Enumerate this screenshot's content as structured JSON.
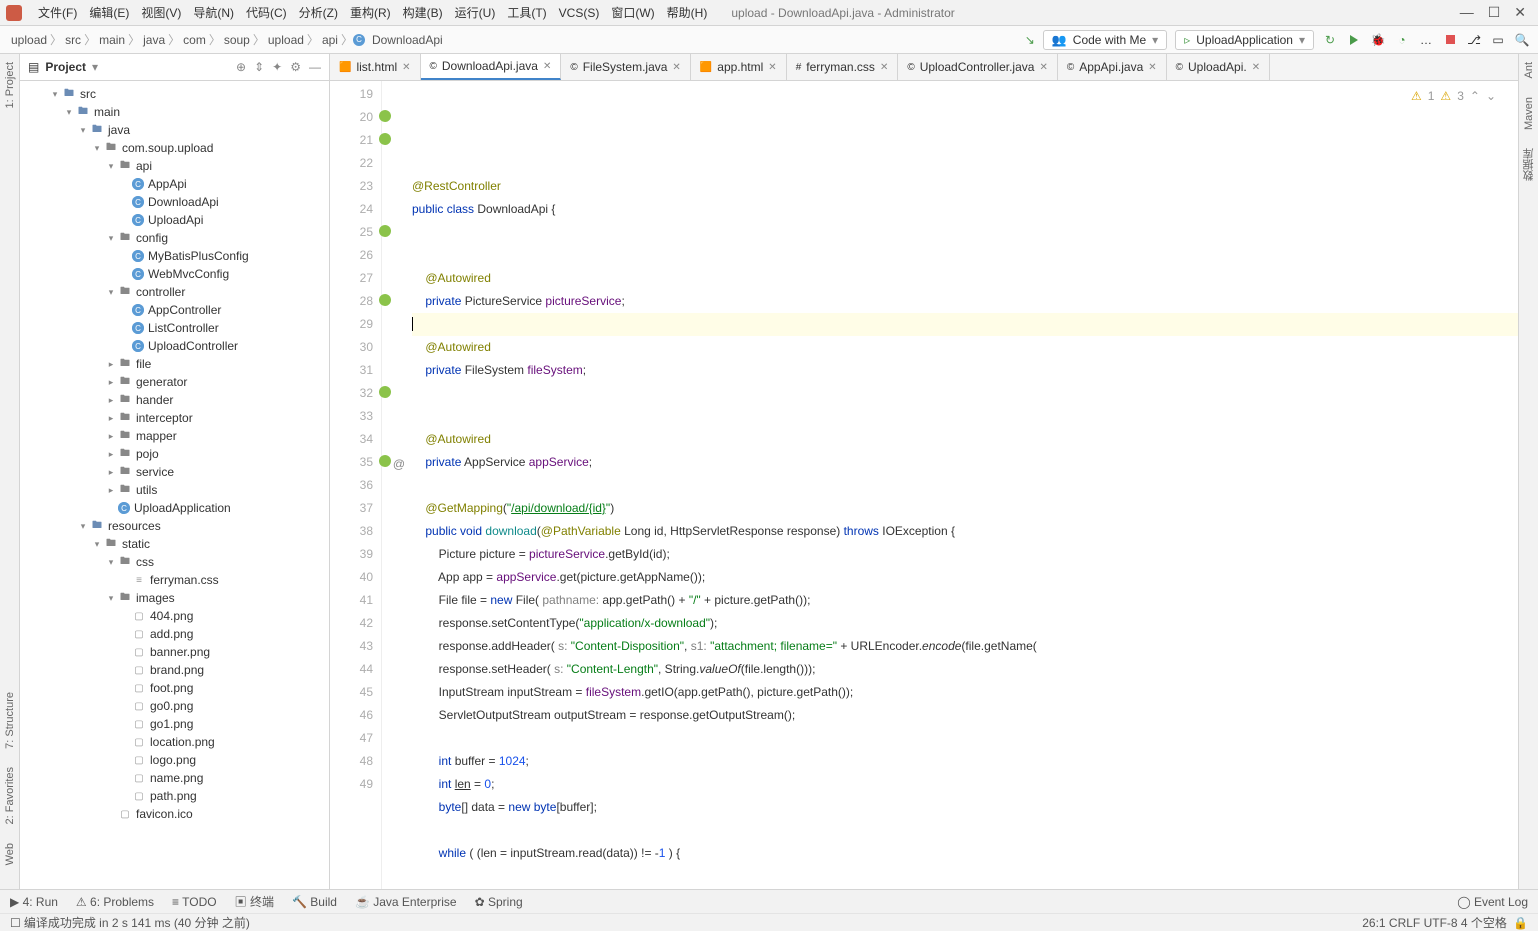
{
  "window_title": "upload - DownloadApi.java - Administrator",
  "menu": [
    "文件(F)",
    "编辑(E)",
    "视图(V)",
    "导航(N)",
    "代码(C)",
    "分析(Z)",
    "重构(R)",
    "构建(B)",
    "运行(U)",
    "工具(T)",
    "VCS(S)",
    "窗口(W)",
    "帮助(H)"
  ],
  "breadcrumbs": [
    "upload",
    "src",
    "main",
    "java",
    "com",
    "soup",
    "upload",
    "api",
    "DownloadApi"
  ],
  "code_with_me": "Code with Me",
  "run_config": "UploadApplication",
  "sidebar_title": "Project",
  "tree": [
    {
      "d": 2,
      "t": "src",
      "tw": "▾",
      "ic": "folder-b"
    },
    {
      "d": 3,
      "t": "main",
      "tw": "▾",
      "ic": "folder-b"
    },
    {
      "d": 4,
      "t": "java",
      "tw": "▾",
      "ic": "folder-b"
    },
    {
      "d": 5,
      "t": "com.soup.upload",
      "tw": "▾",
      "ic": "folder-g"
    },
    {
      "d": 6,
      "t": "api",
      "tw": "▾",
      "ic": "folder-g"
    },
    {
      "d": 7,
      "t": "AppApi",
      "tw": "",
      "ic": "cls"
    },
    {
      "d": 7,
      "t": "DownloadApi",
      "tw": "",
      "ic": "cls"
    },
    {
      "d": 7,
      "t": "UploadApi",
      "tw": "",
      "ic": "cls"
    },
    {
      "d": 6,
      "t": "config",
      "tw": "▾",
      "ic": "folder-g"
    },
    {
      "d": 7,
      "t": "MyBatisPlusConfig",
      "tw": "",
      "ic": "cls"
    },
    {
      "d": 7,
      "t": "WebMvcConfig",
      "tw": "",
      "ic": "cls"
    },
    {
      "d": 6,
      "t": "controller",
      "tw": "▾",
      "ic": "folder-g"
    },
    {
      "d": 7,
      "t": "AppController",
      "tw": "",
      "ic": "cls"
    },
    {
      "d": 7,
      "t": "ListController",
      "tw": "",
      "ic": "cls"
    },
    {
      "d": 7,
      "t": "UploadController",
      "tw": "",
      "ic": "cls"
    },
    {
      "d": 6,
      "t": "file",
      "tw": "▸",
      "ic": "folder-g"
    },
    {
      "d": 6,
      "t": "generator",
      "tw": "▸",
      "ic": "folder-g"
    },
    {
      "d": 6,
      "t": "hander",
      "tw": "▸",
      "ic": "folder-g"
    },
    {
      "d": 6,
      "t": "interceptor",
      "tw": "▸",
      "ic": "folder-g"
    },
    {
      "d": 6,
      "t": "mapper",
      "tw": "▸",
      "ic": "folder-g"
    },
    {
      "d": 6,
      "t": "pojo",
      "tw": "▸",
      "ic": "folder-g"
    },
    {
      "d": 6,
      "t": "service",
      "tw": "▸",
      "ic": "folder-g"
    },
    {
      "d": 6,
      "t": "utils",
      "tw": "▸",
      "ic": "folder-g"
    },
    {
      "d": 6,
      "t": "UploadApplication",
      "tw": "",
      "ic": "cls"
    },
    {
      "d": 4,
      "t": "resources",
      "tw": "▾",
      "ic": "folder-b"
    },
    {
      "d": 5,
      "t": "static",
      "tw": "▾",
      "ic": "folder-g"
    },
    {
      "d": 6,
      "t": "css",
      "tw": "▾",
      "ic": "folder-g"
    },
    {
      "d": 7,
      "t": "ferryman.css",
      "tw": "",
      "ic": "file-ic"
    },
    {
      "d": 6,
      "t": "images",
      "tw": "▾",
      "ic": "folder-g"
    },
    {
      "d": 7,
      "t": "404.png",
      "tw": "",
      "ic": "img-ic"
    },
    {
      "d": 7,
      "t": "add.png",
      "tw": "",
      "ic": "img-ic"
    },
    {
      "d": 7,
      "t": "banner.png",
      "tw": "",
      "ic": "img-ic"
    },
    {
      "d": 7,
      "t": "brand.png",
      "tw": "",
      "ic": "img-ic"
    },
    {
      "d": 7,
      "t": "foot.png",
      "tw": "",
      "ic": "img-ic"
    },
    {
      "d": 7,
      "t": "go0.png",
      "tw": "",
      "ic": "img-ic"
    },
    {
      "d": 7,
      "t": "go1.png",
      "tw": "",
      "ic": "img-ic"
    },
    {
      "d": 7,
      "t": "location.png",
      "tw": "",
      "ic": "img-ic"
    },
    {
      "d": 7,
      "t": "logo.png",
      "tw": "",
      "ic": "img-ic"
    },
    {
      "d": 7,
      "t": "name.png",
      "tw": "",
      "ic": "img-ic"
    },
    {
      "d": 7,
      "t": "path.png",
      "tw": "",
      "ic": "img-ic"
    },
    {
      "d": 6,
      "t": "favicon.ico",
      "tw": "",
      "ic": "img-ic"
    }
  ],
  "tabs": [
    {
      "label": "list.html",
      "ic": "🟧"
    },
    {
      "label": "DownloadApi.java",
      "ic": "©",
      "active": true
    },
    {
      "label": "FileSystem.java",
      "ic": "©"
    },
    {
      "label": "app.html",
      "ic": "🟧"
    },
    {
      "label": "ferryman.css",
      "ic": "#"
    },
    {
      "label": "UploadController.java",
      "ic": "©"
    },
    {
      "label": "AppApi.java",
      "ic": "©"
    },
    {
      "label": "UploadApi.",
      "ic": "©"
    }
  ],
  "code_lines": [
    {
      "n": 19,
      "html": ""
    },
    {
      "n": 20,
      "mark": true,
      "html": "<span class='k-anno'>@RestController</span>"
    },
    {
      "n": 21,
      "mark": true,
      "html": "<span class='k-blue'>public class</span> DownloadApi {"
    },
    {
      "n": 22,
      "html": ""
    },
    {
      "n": 23,
      "html": ""
    },
    {
      "n": 24,
      "html": "    <span class='k-anno'>@Autowired</span>"
    },
    {
      "n": 25,
      "mark": true,
      "html": "    <span class='k-blue'>private</span> PictureService <span class='k-field'>pictureService</span>;"
    },
    {
      "n": 26,
      "hl": true,
      "html": "<span class='caret'></span>"
    },
    {
      "n": 27,
      "html": "    <span class='k-anno'>@Autowired</span>"
    },
    {
      "n": 28,
      "mark": true,
      "html": "    <span class='k-blue'>private</span> FileSystem <span class='k-field'>fileSystem</span>;"
    },
    {
      "n": 29,
      "html": ""
    },
    {
      "n": 30,
      "html": ""
    },
    {
      "n": 31,
      "html": "    <span class='k-anno'>@Autowired</span>"
    },
    {
      "n": 32,
      "mark": true,
      "html": "    <span class='k-blue'>private</span> AppService <span class='k-field'>appService</span>;"
    },
    {
      "n": 33,
      "html": ""
    },
    {
      "n": 34,
      "html": "    <span class='k-anno'>@GetMapping</span>(<span class='k-str'>\"<u>/api/download/{id}</u>\"</span>)"
    },
    {
      "n": 35,
      "mark": true,
      "extra": "@",
      "html": "    <span class='k-blue'>public void</span> <span class='k-teal'>download</span>(<span class='k-anno'>@PathVariable</span> Long id, HttpServletResponse response) <span class='k-blue'>throws</span> IOException {"
    },
    {
      "n": 36,
      "html": "        Picture picture = <span class='k-field'>pictureService</span>.getById(id);"
    },
    {
      "n": 37,
      "html": "        App app = <span class='k-field'>appService</span>.get(picture.getAppName());"
    },
    {
      "n": 38,
      "html": "        File file = <span class='k-blue'>new</span> File( <span class='k-gray'>pathname:</span> app.getPath() + <span class='k-str'>\"/\"</span> + picture.getPath());"
    },
    {
      "n": 39,
      "html": "        response.setContentType(<span class='k-str'>\"application/x-download\"</span>);"
    },
    {
      "n": 40,
      "html": "        response.addHeader( <span class='k-gray'>s:</span> <span class='k-str'>\"Content-Disposition\"</span>, <span class='k-gray'>s1:</span> <span class='k-str'>\"attachment; filename=\"</span> + URLEncoder.<i>encode</i>(file.getName("
    },
    {
      "n": 41,
      "html": "        response.setHeader( <span class='k-gray'>s:</span> <span class='k-str'>\"Content-Length\"</span>, String.<i>valueOf</i>(file.length()));"
    },
    {
      "n": 42,
      "html": "        InputStream inputStream = <span class='k-field'>fileSystem</span>.getIO(app.getPath(), picture.getPath());"
    },
    {
      "n": 43,
      "html": "        ServletOutputStream outputStream = response.getOutputStream();"
    },
    {
      "n": 44,
      "html": ""
    },
    {
      "n": 45,
      "html": "        <span class='k-blue'>int</span> buffer = <span class='k-num'>1024</span>;"
    },
    {
      "n": 46,
      "html": "        <span class='k-blue'>int</span> <u>len</u> = <span class='k-num'>0</span>;"
    },
    {
      "n": 47,
      "html": "        <span class='k-blue'>byte</span>[] data = <span class='k-blue'>new byte</span>[buffer];"
    },
    {
      "n": 48,
      "html": ""
    },
    {
      "n": 49,
      "html": "        <span class='k-blue'>while</span> ( (len = inputStream.read(data)) != -<span class='k-num'>1</span> ) {"
    }
  ],
  "inspections": {
    "warn1": "1",
    "warn2": "3"
  },
  "left_rail": [
    "1: Project"
  ],
  "left_rail_bottom": [
    "7: Structure",
    "2: Favorites",
    "Web"
  ],
  "right_rail": [
    "Ant",
    "Maven",
    "数据库"
  ],
  "bottom_tools": [
    "4: Run",
    "6: Problems",
    "TODO",
    "终端",
    "Build",
    "Java Enterprise",
    "Spring"
  ],
  "event_log": "Event Log",
  "status_msg": "编译成功完成 in 2 s 141 ms (40 分钟 之前)",
  "status_right": "26:1  CRLF  UTF-8  4 个空格"
}
